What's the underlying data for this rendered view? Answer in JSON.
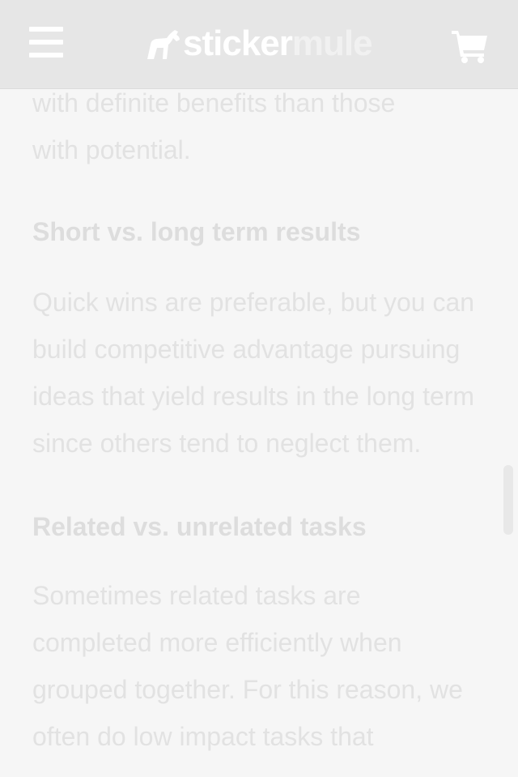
{
  "header": {
    "menu_icon": "hamburger-menu-icon",
    "logo": {
      "part1": "sticker",
      "part2": "mule",
      "icon": "horse-logo-icon"
    },
    "cart_icon": "shopping-cart-icon"
  },
  "article": {
    "intro_line1": "with definite benefits than those",
    "intro_line2": "with potential.",
    "heading1": "Short vs. long term results",
    "para1": "Quick wins are preferable, but you can build competitive advantage pursuing ideas that yield results in the long term since others tend to neglect them.",
    "heading2": "Related vs. unrelated tasks",
    "para2": "Sometimes related tasks are completed more efficiently when grouped together. For this reason, we often do low impact tasks that"
  },
  "colors": {
    "header_bg": "#e6e6e6",
    "page_bg": "#f6f6f6",
    "faded_text": "#e2e2e2"
  }
}
